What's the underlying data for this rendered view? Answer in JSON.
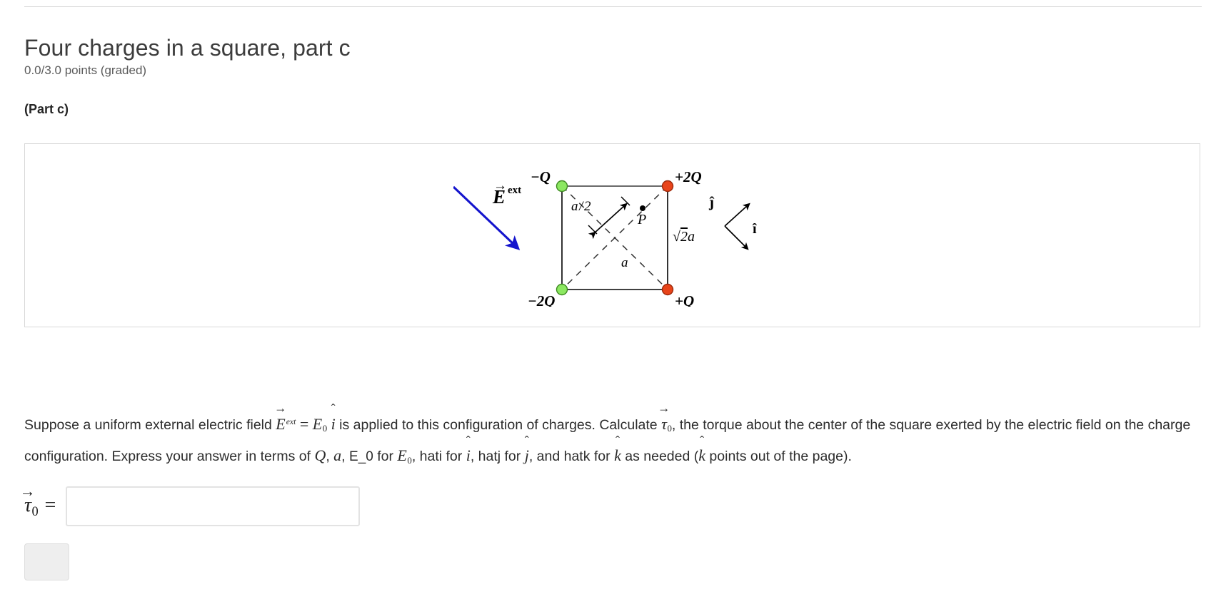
{
  "header": {
    "title": "Four charges in a square, part c",
    "points": "0.0/3.0 points (graded)",
    "part_label": "(Part c)"
  },
  "figure": {
    "caption_alt": "Square with four point charges, external electric field arrow, and unit vector axes",
    "field_label": {
      "symbol": "E",
      "arrow": "→",
      "superscript": "ext"
    },
    "charges": [
      {
        "label": "−Q",
        "position": "top-left",
        "color": "#8ce861",
        "sign": "negative"
      },
      {
        "label": "+2Q",
        "position": "top-right",
        "color": "#e8441a",
        "sign": "positive"
      },
      {
        "label": "−2Q",
        "position": "bottom-left",
        "color": "#8ce861",
        "sign": "negative"
      },
      {
        "label": "+Q",
        "position": "bottom-right",
        "color": "#e8441a",
        "sign": "positive"
      }
    ],
    "annotations": {
      "half_side": "a / 2",
      "point_p": "P",
      "diagonal": "√2a",
      "side": "a"
    },
    "axes": {
      "j_label": "ĵ",
      "i_label": "î"
    },
    "colors": {
      "field_arrow": "#1414cd",
      "square_stroke": "#000000",
      "dashed_stroke": "#3a3a3a",
      "charge_green": "#8ce861",
      "charge_green_border": "#3f8a23",
      "charge_red": "#e8441a",
      "charge_red_border": "#9c2a0c"
    }
  },
  "body": {
    "seg1": "Suppose a uniform external electric field ",
    "field_symbol": "E",
    "field_sup": "ext",
    "eq": " = ",
    "e0": "E",
    "e0_sub": "0",
    "ihat": "i",
    "seg2": " is applied to this configuration of charges. Calculate ",
    "tau": "τ",
    "tau_sub": "0",
    "seg3": ", the torque about the center of the square exerted by the electric field on the charge configuration. Express your answer in terms of ",
    "q_sym": "Q",
    "seg4": ", ",
    "a_sym": "a",
    "seg5": ", ",
    "e0_text": "E_0",
    "seg6": " for ",
    "e0b": "E",
    "e0b_sub": "0",
    "seg7": ", hati for ",
    "ihat2": "i",
    "seg8": ", hatj for ",
    "jhat": "j",
    "seg9": ", and hatk for ",
    "khat": "k",
    "seg10": " as needed (",
    "khat2": "k",
    "seg11": " points out of the page)."
  },
  "answer": {
    "label_symbol": "τ",
    "label_sub": "0",
    "label_eq": "=",
    "value": "",
    "placeholder": "",
    "submit_label": ""
  }
}
